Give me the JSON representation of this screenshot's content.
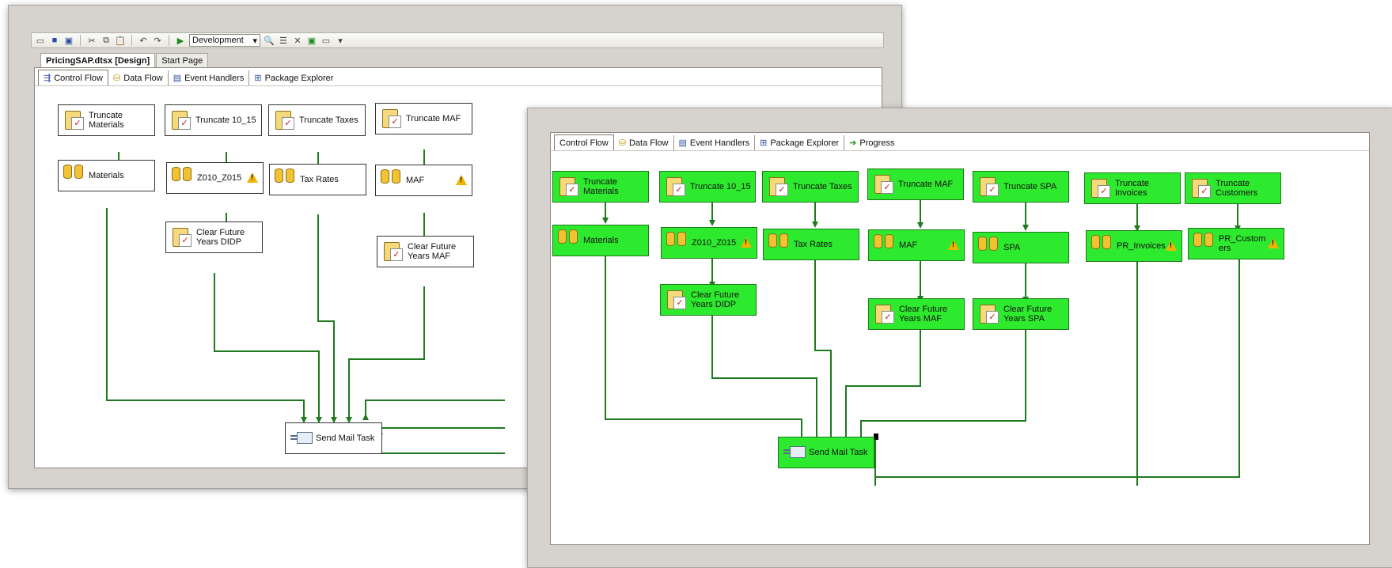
{
  "back_window": {
    "toolbar": {
      "config_value": "Development",
      "icons": [
        "new-item-icon",
        "save-icon",
        "save-all-icon",
        "cut-icon",
        "copy-icon",
        "paste-icon",
        "undo-icon",
        "redo-icon",
        "start-debug-icon",
        "find-icon",
        "properties-icon",
        "toolbox-icon",
        "solution-icon",
        "window-icon",
        "overflow-icon"
      ]
    },
    "doc_tabs": [
      {
        "label": "PricingSAP.dtsx [Design]",
        "active": true
      },
      {
        "label": "Start Page",
        "active": false
      }
    ],
    "designer_tabs": [
      {
        "label": "Control Flow",
        "icon": "control-flow-icon",
        "active": true
      },
      {
        "label": "Data Flow",
        "icon": "data-flow-icon",
        "active": false
      },
      {
        "label": "Event Handlers",
        "icon": "event-handlers-icon",
        "active": false
      },
      {
        "label": "Package Explorer",
        "icon": "package-explorer-icon",
        "active": false
      }
    ],
    "tasks": [
      {
        "label": "Truncate\nMaterials",
        "icon": "sql"
      },
      {
        "label": "Truncate 10_15",
        "icon": "sql"
      },
      {
        "label": "Truncate Taxes",
        "icon": "sql"
      },
      {
        "label": "Truncate MAF",
        "icon": "sql"
      },
      {
        "label": "Materials",
        "icon": "df"
      },
      {
        "label": "Z010_Z015",
        "icon": "df",
        "warning": true
      },
      {
        "label": "Tax Rates",
        "icon": "df"
      },
      {
        "label": "MAF",
        "icon": "df",
        "warning": true
      },
      {
        "label": "Clear Future\nYears DIDP",
        "icon": "sql"
      },
      {
        "label": "Clear Future\nYears MAF",
        "icon": "sql"
      },
      {
        "label": "Send Mail Task",
        "icon": "mail"
      }
    ]
  },
  "front_window": {
    "designer_tabs": [
      {
        "label": "Control Flow",
        "icon": "control-flow-icon",
        "active": true
      },
      {
        "label": "Data Flow",
        "icon": "data-flow-icon",
        "active": false
      },
      {
        "label": "Event Handlers",
        "icon": "event-handlers-icon",
        "active": false
      },
      {
        "label": "Package Explorer",
        "icon": "package-explorer-icon",
        "active": false
      },
      {
        "label": "Progress",
        "icon": "progress-icon",
        "active": false
      }
    ],
    "tasks": [
      {
        "label": "Truncate\nMaterials",
        "icon": "sql"
      },
      {
        "label": "Truncate 10_15",
        "icon": "sql"
      },
      {
        "label": "Truncate Taxes",
        "icon": "sql"
      },
      {
        "label": "Truncate MAF",
        "icon": "sql"
      },
      {
        "label": "Truncate SPA",
        "icon": "sql"
      },
      {
        "label": "Truncate\nInvoices",
        "icon": "sql"
      },
      {
        "label": "Truncate\nCustomers",
        "icon": "sql"
      },
      {
        "label": "Materials",
        "icon": "df"
      },
      {
        "label": "Z010_Z015",
        "icon": "df",
        "warning": true
      },
      {
        "label": "Tax Rates",
        "icon": "df"
      },
      {
        "label": "MAF",
        "icon": "df",
        "warning": true
      },
      {
        "label": "SPA",
        "icon": "df"
      },
      {
        "label": "PR_Invoices",
        "icon": "df",
        "warning": true
      },
      {
        "label": "PR_Custom\ners",
        "icon": "df",
        "warning": true
      },
      {
        "label": "Clear Future\nYears DIDP",
        "icon": "sql"
      },
      {
        "label": "Clear Future\nYears MAF",
        "icon": "sql"
      },
      {
        "label": "Clear Future\nYears SPA",
        "icon": "sql"
      },
      {
        "label": "Send Mail Task",
        "icon": "mail"
      }
    ]
  },
  "colors": {
    "task_success": "#2eea2e",
    "connector": "#1f7a1f",
    "warning": "#f0b400"
  }
}
